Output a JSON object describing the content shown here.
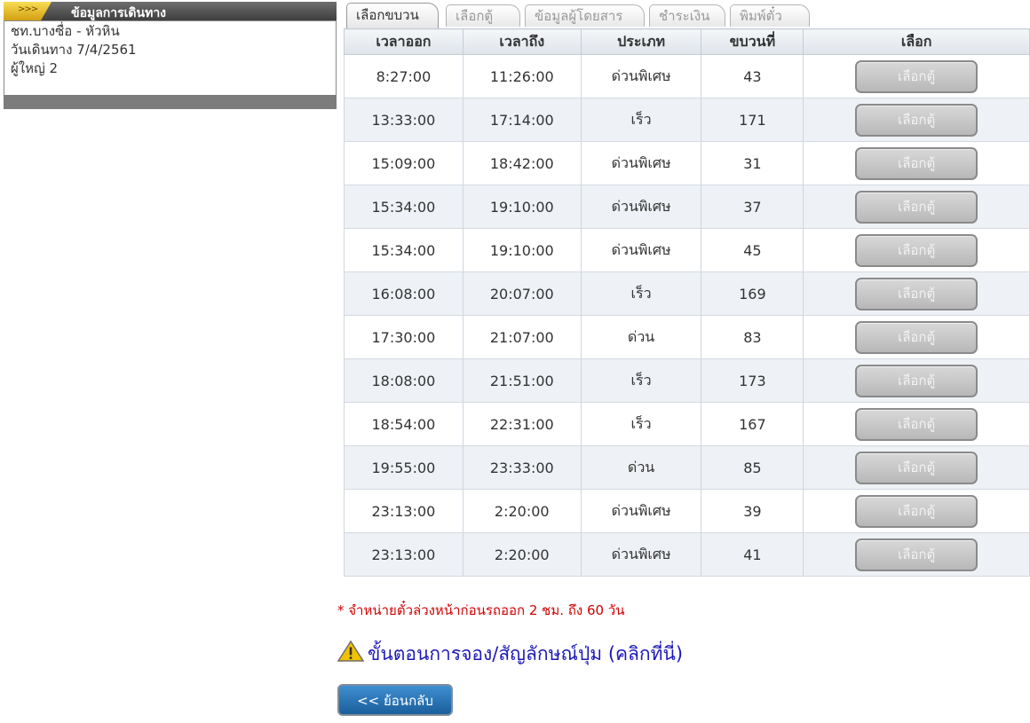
{
  "travel_info": {
    "arrows": ">>>",
    "title": "ข้อมูลการเดินทาง",
    "route": "ชท.บางซื่อ - หัวหิน",
    "date": "วันเดินทาง 7/4/2561",
    "passengers": "ผู้ใหญ่ 2"
  },
  "tabs": [
    {
      "label": "เลือกขบวน",
      "active": true
    },
    {
      "label": "เลือกตู้",
      "active": false
    },
    {
      "label": "ข้อมูลผู้โดยสาร",
      "active": false
    },
    {
      "label": "ชำระเงิน",
      "active": false
    },
    {
      "label": "พิมพ์ตั๋ว",
      "active": false
    }
  ],
  "table": {
    "headers": [
      "เวลาออก",
      "เวลาถึง",
      "ประเภท",
      "ขบวนที่",
      "เลือก"
    ],
    "select_label": "เลือกตู้",
    "rows": [
      {
        "depart": "8:27:00",
        "arrive": "11:26:00",
        "type": "ด่วนพิเศษ",
        "train": "43"
      },
      {
        "depart": "13:33:00",
        "arrive": "17:14:00",
        "type": "เร็ว",
        "train": "171"
      },
      {
        "depart": "15:09:00",
        "arrive": "18:42:00",
        "type": "ด่วนพิเศษ",
        "train": "31"
      },
      {
        "depart": "15:34:00",
        "arrive": "19:10:00",
        "type": "ด่วนพิเศษ",
        "train": "37"
      },
      {
        "depart": "15:34:00",
        "arrive": "19:10:00",
        "type": "ด่วนพิเศษ",
        "train": "45"
      },
      {
        "depart": "16:08:00",
        "arrive": "20:07:00",
        "type": "เร็ว",
        "train": "169"
      },
      {
        "depart": "17:30:00",
        "arrive": "21:07:00",
        "type": "ด่วน",
        "train": "83"
      },
      {
        "depart": "18:08:00",
        "arrive": "21:51:00",
        "type": "เร็ว",
        "train": "173"
      },
      {
        "depart": "18:54:00",
        "arrive": "22:31:00",
        "type": "เร็ว",
        "train": "167"
      },
      {
        "depart": "19:55:00",
        "arrive": "23:33:00",
        "type": "ด่วน",
        "train": "85"
      },
      {
        "depart": "23:13:00",
        "arrive": "2:20:00",
        "type": "ด่วนพิเศษ",
        "train": "39"
      },
      {
        "depart": "23:13:00",
        "arrive": "2:20:00",
        "type": "ด่วนพิเศษ",
        "train": "41"
      }
    ]
  },
  "note": "* จำหน่ายตั๋วล่วงหน้าก่อนรถออก 2 ชม. ถึง 60 วัน",
  "steps_link": "ขั้นตอนการจอง/สัญลักษณ์ปุ่ม (คลิกที่นี่)",
  "back_button": "<< ย้อนกลับ",
  "colors": {
    "note": "#d20000",
    "link": "#1b19b7",
    "back_button": "#1f6aa8",
    "tab_accent": "#e8b41c"
  }
}
